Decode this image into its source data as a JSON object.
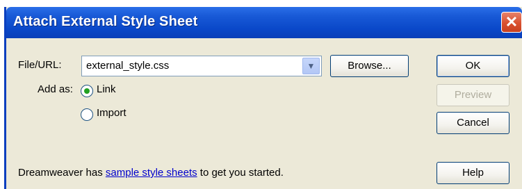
{
  "window": {
    "title": "Attach External Style Sheet",
    "close_symbol": "✕"
  },
  "file": {
    "label": "File/URL:",
    "value": "external_style.css",
    "dropdown_icon": "chevron-down-icon"
  },
  "buttons": {
    "browse": "Browse...",
    "ok": "OK",
    "preview": "Preview",
    "cancel": "Cancel",
    "help": "Help"
  },
  "add_as": {
    "label": "Add as:",
    "options": [
      {
        "label": "Link",
        "selected": true
      },
      {
        "label": "Import",
        "selected": false
      }
    ]
  },
  "footer": {
    "prefix": "Dreamweaver has ",
    "link": "sample style sheets",
    "suffix": " to get you started."
  },
  "colors": {
    "titlebar": "#0a48c9",
    "dialog_bg": "#ece9d8",
    "link": "#0000cc",
    "radio_selected": "#21a121"
  }
}
